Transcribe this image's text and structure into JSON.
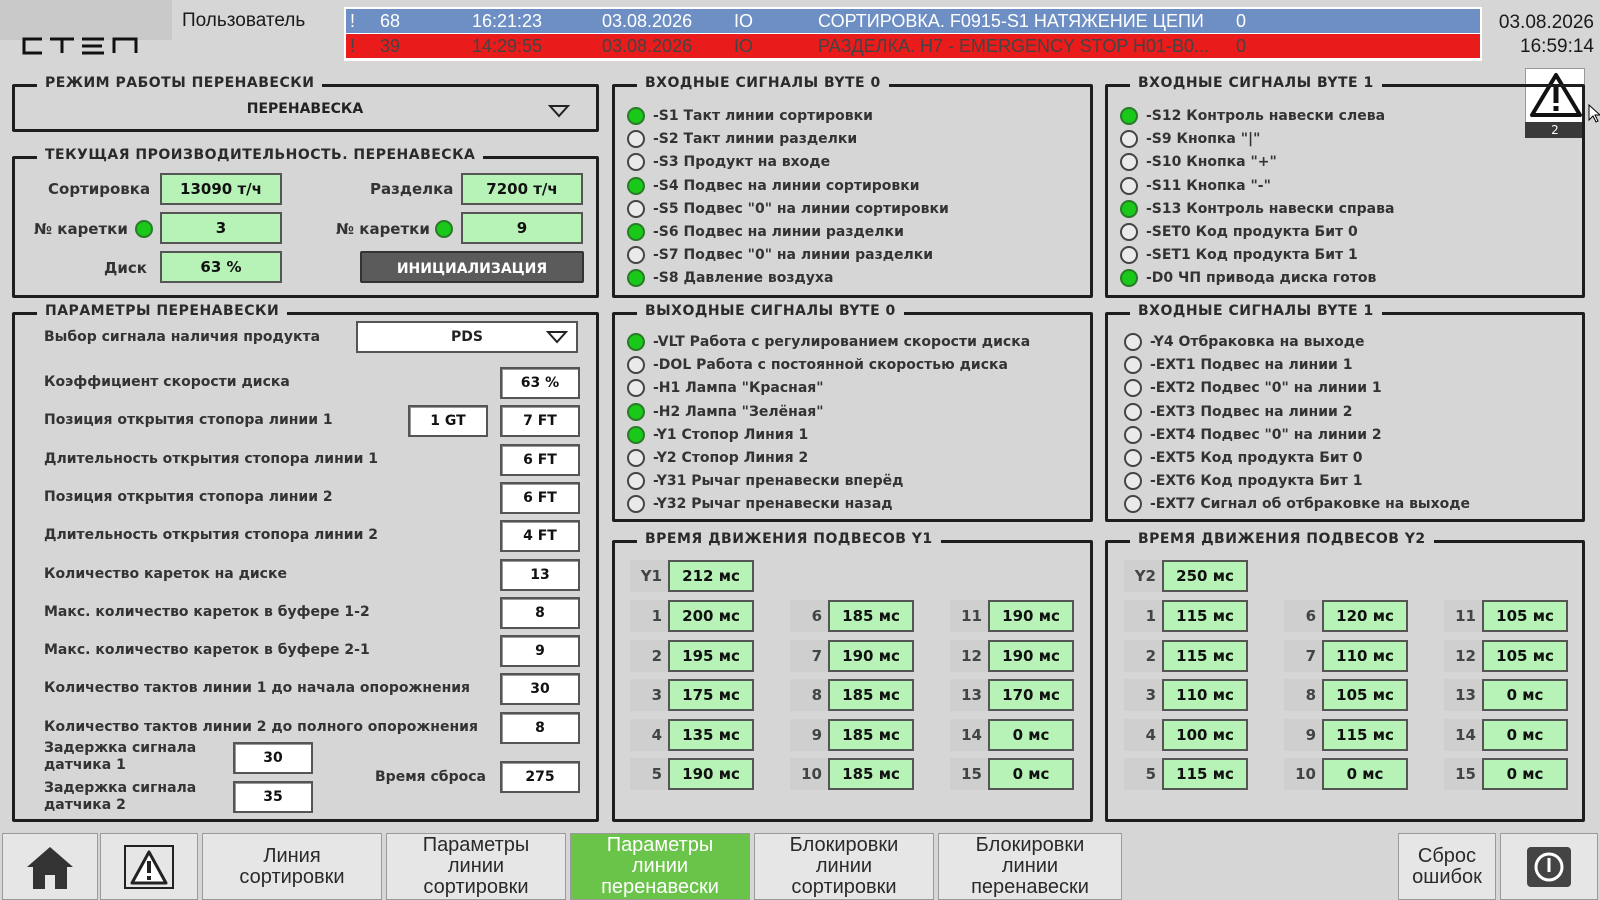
{
  "header": {
    "logo_text": "СТЭП",
    "user_label": "Пользователь",
    "date": "03.08.2026",
    "time": "16:59:14",
    "warning_count": "2"
  },
  "alarms": [
    {
      "mark": "!",
      "id": "68",
      "time": "16:21:23",
      "date": "03.08.2026",
      "type": "IO",
      "text": "СОРТИРОВКА. F0915-S1 НАТЯЖЕНИЕ ЦЕПИ",
      "state": "0"
    },
    {
      "mark": "!",
      "id": "39",
      "time": "14:29:55",
      "date": "03.08.2026",
      "type": "IO",
      "text": "РАЗДЕЛКА. H7 - EMERGENCY STOP H01-B0...",
      "state": "0"
    }
  ],
  "mode": {
    "title": "РЕЖИМ РАБОТЫ ПЕРЕНАВЕСКИ",
    "value": "ПЕРЕНАВЕСКА"
  },
  "perf": {
    "title": "ТЕКУЩАЯ ПРОИЗВОДИТЕЛЬНОСТЬ. ПЕРЕНАВЕСКА",
    "sort_label": "Сортировка",
    "sort_value": "13090 т/ч",
    "cut_label": "Разделка",
    "cut_value": "7200 т/ч",
    "carriage_label": "№ каретки",
    "carriage1_value": "3",
    "carriage2_value": "9",
    "disk_label": "Диск",
    "disk_value": "63 %",
    "init_button": "ИНИЦИАЛИЗАЦИЯ"
  },
  "params": {
    "title": "ПАРАМЕТРЫ ПЕРЕНАВЕСКИ",
    "signal_select_label": "Выбор сигнала наличия продукта",
    "signal_select_value": "PDS",
    "rows": [
      {
        "label": "Коэффициент скорости диска",
        "value": "63 %"
      },
      {
        "label": "Позиция открытия стопора линии 1",
        "value": "7 FT",
        "extra": "1 GT"
      },
      {
        "label": "Длительность  открытия стопора линии 1",
        "value": "6 FT"
      },
      {
        "label": "Позиция открытия стопора линии 2",
        "value": "6 FT"
      },
      {
        "label": "Длительность  открытия стопора линии 2",
        "value": "4 FT"
      },
      {
        "label": "Количество кареток на диске",
        "value": "13"
      },
      {
        "label": "Макс. количество кареток в буфере 1-2",
        "value": "8"
      },
      {
        "label": "Макс. количество кареток в буфере 2-1",
        "value": "9"
      },
      {
        "label": "Количество тактов линии 1 до начала опорожнения",
        "value": "30"
      },
      {
        "label": "Количество тактов линии 2 до полного опорожнения",
        "value": "8"
      }
    ],
    "delay1_label_a": "Задержка сигнала",
    "delay1_label_b": "датчика 1",
    "delay1_value": "30",
    "delay2_label_a": "Задержка сигнала",
    "delay2_label_b": "датчика 2",
    "delay2_value": "35",
    "reset_time_label": "Время сброса",
    "reset_time_value": "275"
  },
  "in_byte0": {
    "title": "ВХОДНЫЕ СИГНАЛЫ BYTE 0",
    "signals": [
      {
        "text": "-S1 Такт линии сортировки",
        "on": true
      },
      {
        "text": "-S2 Такт линии разделки",
        "on": false
      },
      {
        "text": "-S3 Продукт на входе",
        "on": false
      },
      {
        "text": "-S4 Подвес на линии сортировки",
        "on": true
      },
      {
        "text": "-S5 Подвес \"0\" на линии сортировки",
        "on": false
      },
      {
        "text": "-S6 Подвес на линии разделки",
        "on": true
      },
      {
        "text": "-S7 Подвес \"0\" на линии разделки",
        "on": false
      },
      {
        "text": "-S8 Давление воздуха",
        "on": true
      }
    ]
  },
  "in_byte1": {
    "title": "ВХОДНЫЕ СИГНАЛЫ BYTE 1",
    "signals": [
      {
        "text": "-S12 Контроль навески слева",
        "on": true
      },
      {
        "text": "-S9 Кнопка \"|\"",
        "on": false
      },
      {
        "text": "-S10 Кнопка \"+\"",
        "on": false
      },
      {
        "text": "-S11 Кнопка \"-\"",
        "on": false
      },
      {
        "text": "-S13 Контроль навески справа",
        "on": true
      },
      {
        "text": "-SET0 Код продукта Бит 0",
        "on": false
      },
      {
        "text": "-SET1 Код продукта Бит 1",
        "on": false
      },
      {
        "text": "-D0 ЧП привода диска готов",
        "on": true
      }
    ]
  },
  "out_byte0": {
    "title": "ВЫХОДНЫЕ СИГНАЛЫ BYTE 0",
    "signals": [
      {
        "text": "-VLT Работа с регулированием скорости диска",
        "on": true
      },
      {
        "text": "-DOL Работа с постоянной скоростью диска",
        "on": false
      },
      {
        "text": "-H1 Лампа \"Красная\"",
        "on": false
      },
      {
        "text": "-H2 Лампа \"Зелёная\"",
        "on": true
      },
      {
        "text": "-Y1 Стопор Линия 1",
        "on": true
      },
      {
        "text": "-Y2 Стопор Линия 2",
        "on": false
      },
      {
        "text": "-Y31 Рычаг пренавески вперёд",
        "on": false
      },
      {
        "text": "-Y32 Рычаг пренавески назад",
        "on": false
      }
    ]
  },
  "in_byte1b": {
    "title": "ВХОДНЫЕ СИГНАЛЫ BYTE 1",
    "signals": [
      {
        "text": "-Y4 Отбраковка на выходе",
        "on": false
      },
      {
        "text": "-EXT1 Подвес на линии 1",
        "on": false
      },
      {
        "text": "-EXT2 Подвес \"0\" на линии 1",
        "on": false
      },
      {
        "text": "-EXT3 Подвес на линии 2",
        "on": false
      },
      {
        "text": "-EXT4 Подвес \"0\" на линии 2",
        "on": false
      },
      {
        "text": "-EXT5 Код продукта Бит 0",
        "on": false
      },
      {
        "text": "-EXT6 Код продукта Бит 1",
        "on": false
      },
      {
        "text": "-EXT7 Сигнал об отбраковке на выходе",
        "on": false
      }
    ]
  },
  "time_y1": {
    "title": "ВРЕМЯ ДВИЖЕНИЯ ПОДВЕСОВ Y1",
    "head_label": "Y1",
    "head_value": "212 мс",
    "cells": [
      {
        "n": "1",
        "v": "200 мс"
      },
      {
        "n": "2",
        "v": "195 мс"
      },
      {
        "n": "3",
        "v": "175 мс"
      },
      {
        "n": "4",
        "v": "135 мс"
      },
      {
        "n": "5",
        "v": "190 мс"
      },
      {
        "n": "6",
        "v": "185 мс"
      },
      {
        "n": "7",
        "v": "190 мс"
      },
      {
        "n": "8",
        "v": "185 мс"
      },
      {
        "n": "9",
        "v": "185 мс"
      },
      {
        "n": "10",
        "v": "185 мс"
      },
      {
        "n": "11",
        "v": "190 мс"
      },
      {
        "n": "12",
        "v": "190 мс"
      },
      {
        "n": "13",
        "v": "170 мс"
      },
      {
        "n": "14",
        "v": "0 мс"
      },
      {
        "n": "15",
        "v": "0 мс"
      }
    ]
  },
  "time_y2": {
    "title": "ВРЕМЯ ДВИЖЕНИЯ ПОДВЕСОВ Y2",
    "head_label": "Y2",
    "head_value": "250 мс",
    "cells": [
      {
        "n": "1",
        "v": "115 мс"
      },
      {
        "n": "2",
        "v": "115 мс"
      },
      {
        "n": "3",
        "v": "110 мс"
      },
      {
        "n": "4",
        "v": "100 мс"
      },
      {
        "n": "5",
        "v": "115 мс"
      },
      {
        "n": "6",
        "v": "120 мс"
      },
      {
        "n": "7",
        "v": "110 мс"
      },
      {
        "n": "8",
        "v": "105 мс"
      },
      {
        "n": "9",
        "v": "115 мс"
      },
      {
        "n": "10",
        "v": "0 мс"
      },
      {
        "n": "11",
        "v": "105 мс"
      },
      {
        "n": "12",
        "v": "105 мс"
      },
      {
        "n": "13",
        "v": "0 мс"
      },
      {
        "n": "14",
        "v": "0 мс"
      },
      {
        "n": "15",
        "v": "0 мс"
      }
    ]
  },
  "nav": {
    "line_sort": [
      "Линия",
      "сортировки"
    ],
    "params_sort": [
      "Параметры",
      "линии",
      "сортировки"
    ],
    "params_rehang": [
      "Параметры",
      "линии",
      "перенавески"
    ],
    "lock_sort": [
      "Блокировки",
      "линии",
      "сортировки"
    ],
    "lock_rehang": [
      "Блокировки",
      "линии",
      "перенавески"
    ],
    "reset_errors": [
      "Сброс",
      "ошибок"
    ]
  },
  "colors": {
    "signal_on": "#19c819",
    "field_green": "#b7f2b6",
    "alarm_active": "#ea1b1b",
    "alarm_ack": "#6e8fc4",
    "nav_active": "#6bc44a"
  }
}
